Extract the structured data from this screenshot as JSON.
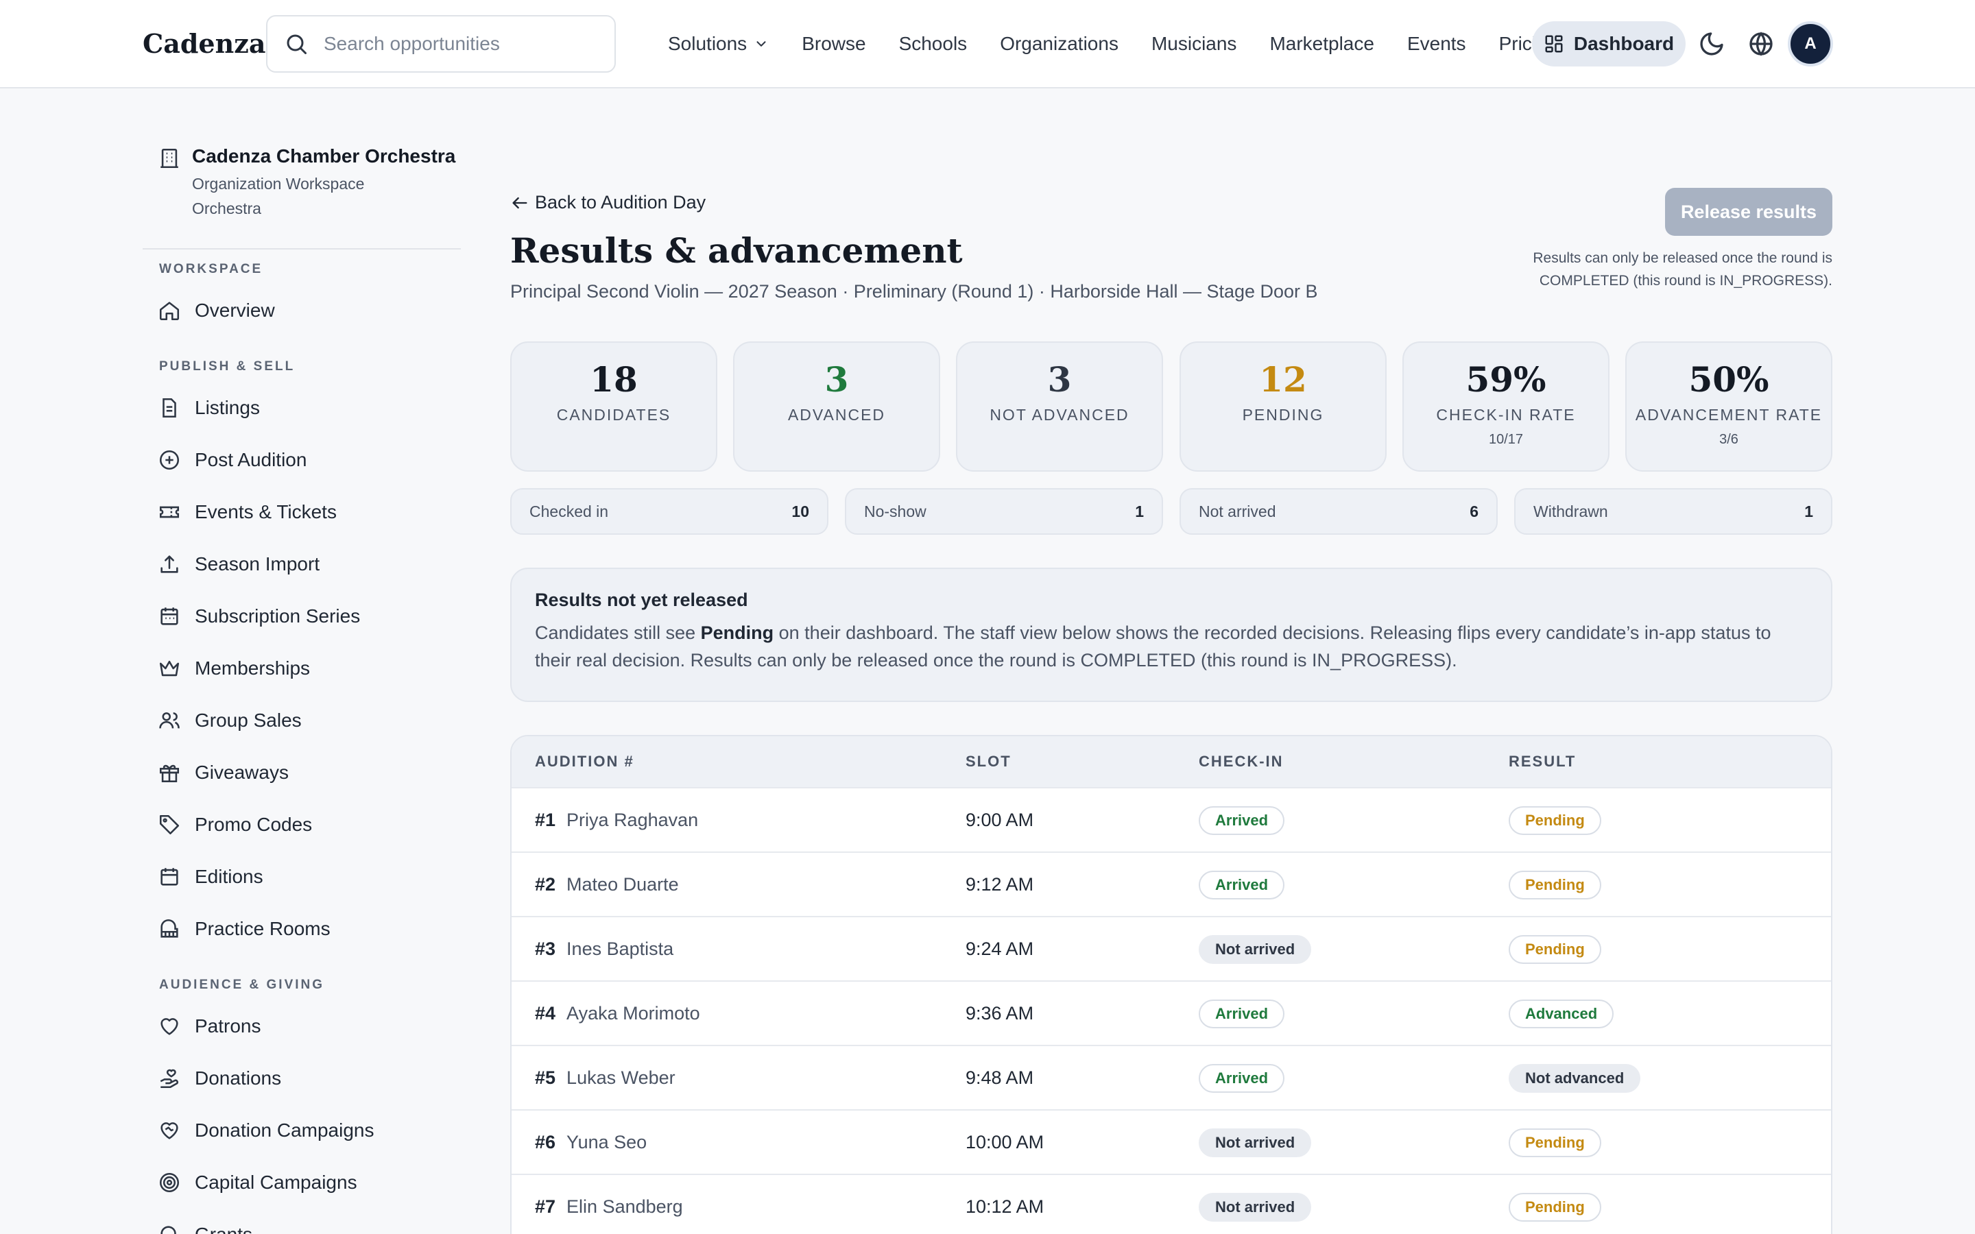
{
  "nav": {
    "brand": "Cadenza",
    "search_placeholder": "Search opportunities",
    "links": [
      "Solutions",
      "Browse",
      "Schools",
      "Organizations",
      "Musicians",
      "Marketplace",
      "Events",
      "Pricing"
    ],
    "dashboard_label": "Dashboard",
    "avatar_initial": "A"
  },
  "sidebar": {
    "org_name": "Cadenza Chamber Orchestra",
    "org_workspace": "Organization Workspace",
    "org_type": "Orchestra",
    "sections": [
      {
        "label": "WORKSPACE",
        "items": [
          "Overview"
        ]
      },
      {
        "label": "PUBLISH & SELL",
        "items": [
          "Listings",
          "Post Audition",
          "Events & Tickets",
          "Season Import",
          "Subscription Series",
          "Memberships",
          "Group Sales",
          "Giveaways",
          "Promo Codes",
          "Editions",
          "Practice Rooms"
        ]
      },
      {
        "label": "AUDIENCE & GIVING",
        "items": [
          "Patrons",
          "Donations",
          "Donation Campaigns",
          "Capital Campaigns",
          "Grants"
        ]
      }
    ]
  },
  "main": {
    "back_label": "Back to Audition Day",
    "title": "Results & advancement",
    "subtitle": "Principal Second Violin — 2027 Season · Preliminary (Round 1) · Harborside Hall — Stage Door B",
    "release_button": "Release results",
    "release_note": "Results can only be released once the round is COMPLETED (this round is IN_PROGRESS).",
    "stats": [
      {
        "value": "18",
        "label": "CANDIDATES",
        "sub": "",
        "color": "#141a24"
      },
      {
        "value": "3",
        "label": "ADVANCED",
        "sub": "",
        "color": "#1f7a3d"
      },
      {
        "value": "3",
        "label": "NOT ADVANCED",
        "sub": "",
        "color": "#2e3643"
      },
      {
        "value": "12",
        "label": "PENDING",
        "sub": "",
        "color": "#c48a12"
      },
      {
        "value": "59%",
        "label": "CHECK-IN RATE",
        "sub": "10/17",
        "color": "#141a24"
      },
      {
        "value": "50%",
        "label": "ADVANCEMENT RATE",
        "sub": "3/6",
        "color": "#141a24"
      }
    ],
    "pills": [
      {
        "label": "Checked in",
        "value": "10"
      },
      {
        "label": "No-show",
        "value": "1"
      },
      {
        "label": "Not arrived",
        "value": "6"
      },
      {
        "label": "Withdrawn",
        "value": "1"
      }
    ],
    "notice": {
      "title": "Results not yet released",
      "body_before": "Candidates still see ",
      "body_bold": "Pending",
      "body_after": " on their dashboard. The staff view below shows the recorded decisions. Releasing flips every candidate’s in-app status to their real decision. Results can only be released once the round is COMPLETED (this round is IN_PROGRESS)."
    },
    "table": {
      "headers": [
        "AUDITION #",
        "SLOT",
        "CHECK-IN",
        "RESULT"
      ],
      "rows": [
        {
          "num": "#1",
          "name": "Priya Raghavan",
          "slot": "9:00 AM",
          "checkin": "Arrived",
          "result": "Pending"
        },
        {
          "num": "#2",
          "name": "Mateo Duarte",
          "slot": "9:12 AM",
          "checkin": "Arrived",
          "result": "Pending"
        },
        {
          "num": "#3",
          "name": "Ines Baptista",
          "slot": "9:24 AM",
          "checkin": "Not arrived",
          "result": "Pending"
        },
        {
          "num": "#4",
          "name": "Ayaka Morimoto",
          "slot": "9:36 AM",
          "checkin": "Arrived",
          "result": "Advanced"
        },
        {
          "num": "#5",
          "name": "Lukas Weber",
          "slot": "9:48 AM",
          "checkin": "Arrived",
          "result": "Not advanced"
        },
        {
          "num": "#6",
          "name": "Yuna Seo",
          "slot": "10:00 AM",
          "checkin": "Not arrived",
          "result": "Pending"
        },
        {
          "num": "#7",
          "name": "Elin Sandberg",
          "slot": "10:12 AM",
          "checkin": "Not arrived",
          "result": "Pending"
        }
      ]
    }
  }
}
